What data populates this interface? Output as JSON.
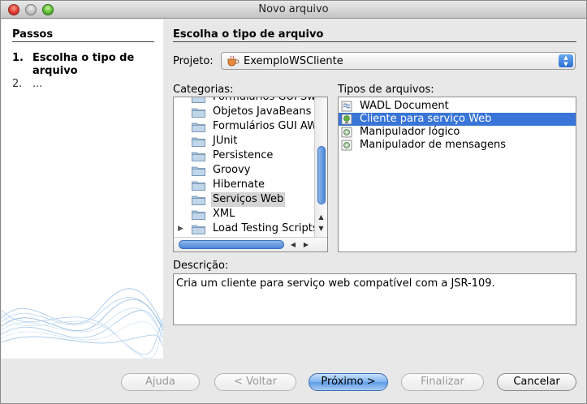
{
  "window": {
    "title": "Novo arquivo"
  },
  "steps": {
    "title": "Passos",
    "items": [
      {
        "num": "1.",
        "label": "Escolha o tipo de arquivo"
      },
      {
        "num": "2.",
        "label": "..."
      }
    ]
  },
  "main": {
    "section_title": "Escolha o tipo de arquivo",
    "project_label": "Projeto:",
    "project_value": "ExemploWSCliente",
    "categories_label": "Categorias:",
    "categories": [
      {
        "label": "Formulários GUI Swing",
        "selected": false,
        "expandable": false
      },
      {
        "label": "Objetos JavaBeans",
        "selected": false,
        "expandable": false
      },
      {
        "label": "Formulários GUI AWT",
        "selected": false,
        "expandable": false
      },
      {
        "label": "JUnit",
        "selected": false,
        "expandable": false
      },
      {
        "label": "Persistence",
        "selected": false,
        "expandable": false
      },
      {
        "label": "Groovy",
        "selected": false,
        "expandable": false
      },
      {
        "label": "Hibernate",
        "selected": false,
        "expandable": false
      },
      {
        "label": "Serviços Web",
        "selected": true,
        "expandable": false
      },
      {
        "label": "XML",
        "selected": false,
        "expandable": false
      },
      {
        "label": "Load Testing Scripts",
        "selected": false,
        "expandable": true
      }
    ],
    "types_label": "Tipos de arquivos:",
    "file_types": [
      {
        "label": "WADL Document",
        "icon": "wadl-doc-icon",
        "selected": false
      },
      {
        "label": "Cliente para serviço Web",
        "icon": "globe-client-icon",
        "selected": true
      },
      {
        "label": "Manipulador lógico",
        "icon": "handler-icon",
        "selected": false
      },
      {
        "label": "Manipulador de mensagens",
        "icon": "handler-icon",
        "selected": false
      }
    ],
    "description_label": "Descrição:",
    "description": "Cria um cliente para serviço web compatível com a JSR-109."
  },
  "buttons": {
    "help": "Ajuda",
    "back": "< Voltar",
    "next": "Próximo >",
    "finish": "Finalizar",
    "cancel": "Cancelar"
  },
  "colors": {
    "selection": "#3875d7",
    "accent": "#5d9be6"
  }
}
